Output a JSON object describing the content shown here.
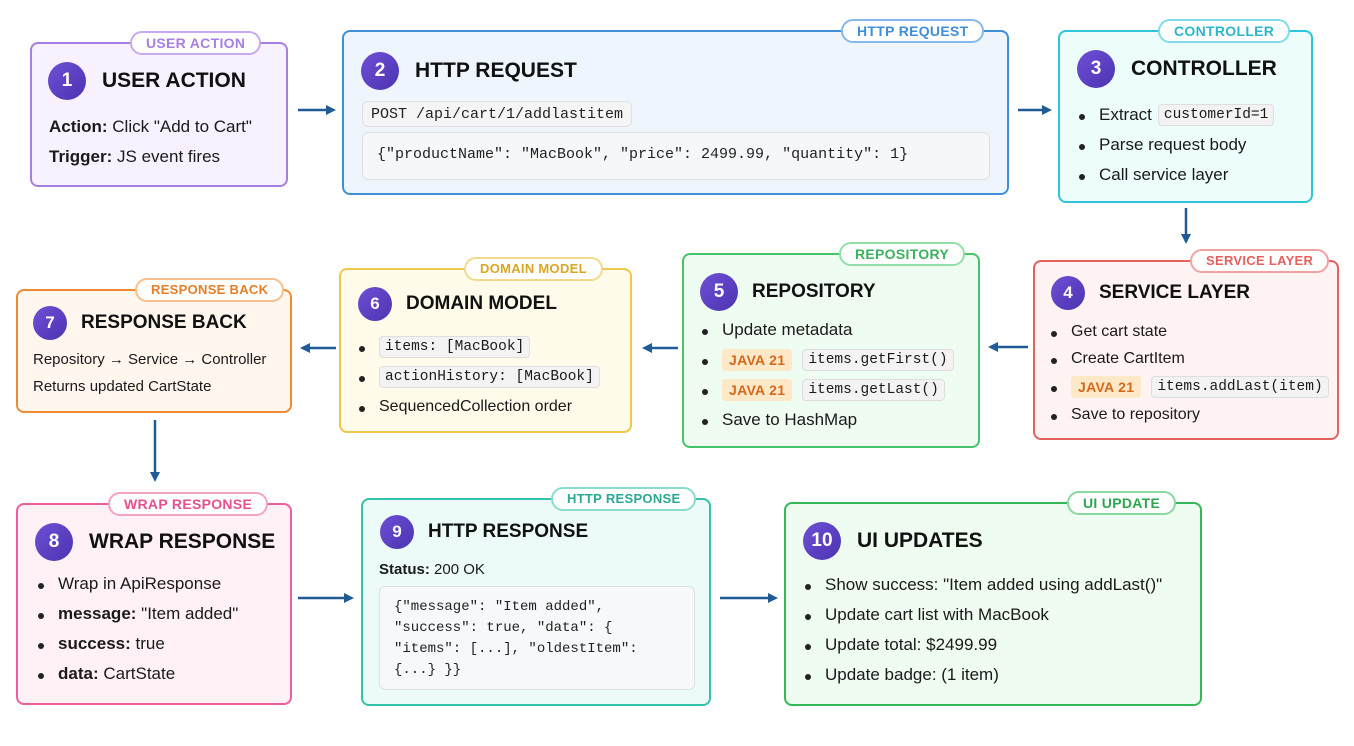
{
  "steps": {
    "s1": {
      "tag": "USER ACTION",
      "num": "1",
      "title": "USER ACTION",
      "action_label": "Action:",
      "action_value": "Click \"Add to Cart\"",
      "trigger_label": "Trigger:",
      "trigger_value": "JS event fires"
    },
    "s2": {
      "tag": "HTTP REQUEST",
      "num": "2",
      "title": "HTTP REQUEST",
      "endpoint": "POST /api/cart/1/addlastitem",
      "body": "{\"productName\": \"MacBook\", \"price\": 2499.99, \"quantity\": 1}"
    },
    "s3": {
      "tag": "CONTROLLER",
      "num": "3",
      "title": "CONTROLLER",
      "b1_text": "Extract",
      "b1_code": "customerId=1",
      "b2": "Parse request body",
      "b3": "Call service layer"
    },
    "s4": {
      "tag": "SERVICE LAYER",
      "num": "4",
      "title": "SERVICE LAYER",
      "b1": "Get cart state",
      "b2": "Create CartItem",
      "b3_badge": "JAVA 21",
      "b3_code": "items.addLast(item)",
      "b4": "Save to repository"
    },
    "s5": {
      "tag": "REPOSITORY",
      "num": "5",
      "title": "REPOSITORY",
      "b1": "Update metadata",
      "b2_badge": "JAVA 21",
      "b2_code": "items.getFirst()",
      "b3_badge": "JAVA 21",
      "b3_code": "items.getLast()",
      "b4": "Save to HashMap"
    },
    "s6": {
      "tag": "DOMAIN MODEL",
      "num": "6",
      "title": "DOMAIN MODEL",
      "b1_code": "items: [MacBook]",
      "b2_code": "actionHistory: [MacBook]",
      "b3": "SequencedCollection order"
    },
    "s7": {
      "tag": "RESPONSE BACK",
      "num": "7",
      "title": "RESPONSE BACK",
      "l1": "Repository → Service → Controller",
      "l2": "Returns updated CartState"
    },
    "s8": {
      "tag": "WRAP RESPONSE",
      "num": "8",
      "title": "WRAP RESPONSE",
      "b1": "Wrap in ApiResponse",
      "b2_label": "message:",
      "b2_value": "\"Item added\"",
      "b3_label": "success:",
      "b3_value": "true",
      "b4_label": "data:",
      "b4_value": "CartState"
    },
    "s9": {
      "tag": "HTTP RESPONSE",
      "num": "9",
      "title": "HTTP RESPONSE",
      "status_label": "Status:",
      "status_value": "200 OK",
      "json_l1": "{\"message\": \"Item added\",",
      "json_l2": "\"success\": true, \"data\": {",
      "json_l3": "\"items\": [...], \"oldestItem\":",
      "json_l4": "{...} }}"
    },
    "s10": {
      "tag": "UI UPDATE",
      "num": "10",
      "title": "UI UPDATES",
      "b1": "Show success: \"Item added using addLast()\"",
      "b2": "Update cart list with MacBook",
      "b3": "Update total: $2499.99",
      "b4": "Update badge: (1 item)"
    }
  },
  "colors": {
    "purple": "#a77fe0",
    "blue": "#3f8fd8",
    "cyan": "#2cc5dc",
    "red": "#e4615f",
    "green": "#45c46a",
    "yellow": "#efc74a",
    "orange": "#f08a32",
    "pink": "#ee5f9c",
    "teal": "#35c2ad",
    "uigreen": "#35b85a",
    "arrow": "#1f5c96",
    "number_circle": "#5a3fc0"
  }
}
